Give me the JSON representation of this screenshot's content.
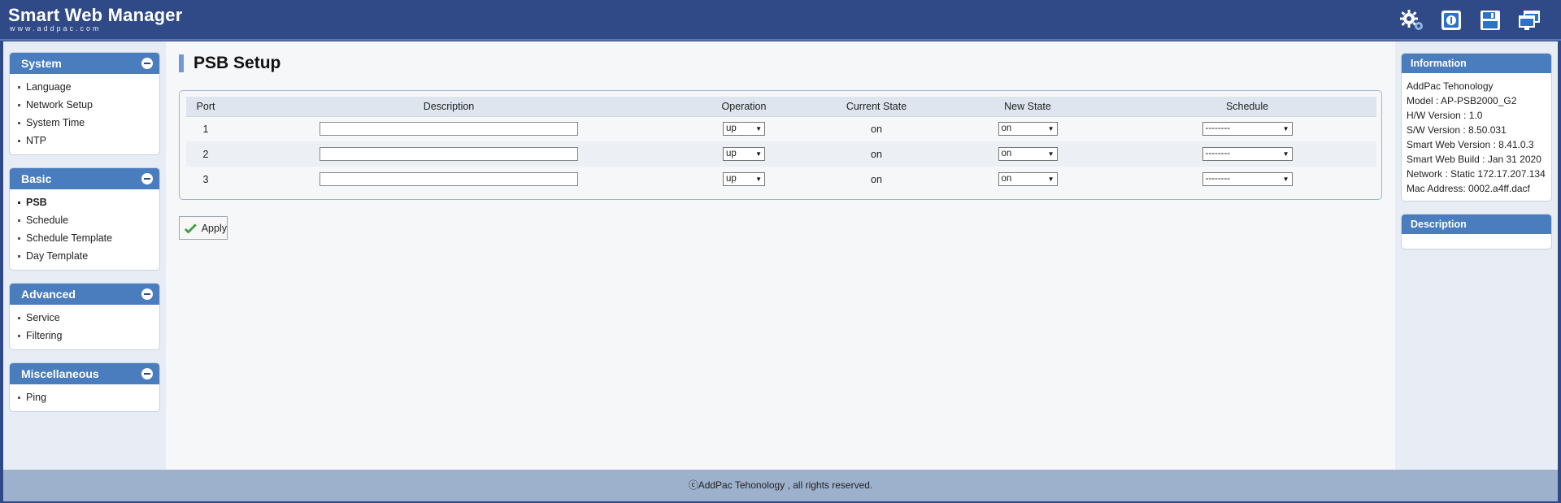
{
  "header": {
    "title": "Smart Web Manager",
    "subtitle": "www.addpac.com",
    "icons": [
      "settings-gear-icon",
      "info-icon",
      "save-icon",
      "windows-icon"
    ]
  },
  "sidebar": {
    "sections": [
      {
        "title": "System",
        "items": [
          "Language",
          "Network Setup",
          "System Time",
          "NTP"
        ]
      },
      {
        "title": "Basic",
        "items": [
          "PSB",
          "Schedule",
          "Schedule Template",
          "Day Template"
        ],
        "active": "PSB"
      },
      {
        "title": "Advanced",
        "items": [
          "Service",
          "Filtering"
        ]
      },
      {
        "title": "Miscellaneous",
        "items": [
          "Ping"
        ]
      }
    ]
  },
  "main": {
    "title": "PSB Setup",
    "table": {
      "headers": [
        "Port",
        "Description",
        "Operation",
        "Current State",
        "New State",
        "Schedule"
      ],
      "rows": [
        {
          "port": "1",
          "description": "",
          "operation": "up",
          "current_state": "on",
          "new_state": "on",
          "schedule": "--------"
        },
        {
          "port": "2",
          "description": "",
          "operation": "up",
          "current_state": "on",
          "new_state": "on",
          "schedule": "--------"
        },
        {
          "port": "3",
          "description": "",
          "operation": "up",
          "current_state": "on",
          "new_state": "on",
          "schedule": "--------"
        }
      ]
    },
    "apply_label": "Apply"
  },
  "info": {
    "title": "Information",
    "lines": [
      "AddPac Tehonology",
      "Model : AP-PSB2000_G2",
      "H/W Version : 1.0",
      "S/W Version : 8.50.031",
      "Smart Web Version : 8.41.0.3",
      "Smart Web Build : Jan 31 2020",
      "Network : Static 172.17.207.134",
      "Mac Address: 0002.a4ff.dacf"
    ]
  },
  "description_panel": {
    "title": "Description"
  },
  "footer": {
    "text": "ⓒAddPac Tehonology , all rights reserved."
  },
  "colors": {
    "header_bg": "#2f4a86",
    "panel_header": "#4a7dbd",
    "footer_bg": "#9db0cc"
  }
}
